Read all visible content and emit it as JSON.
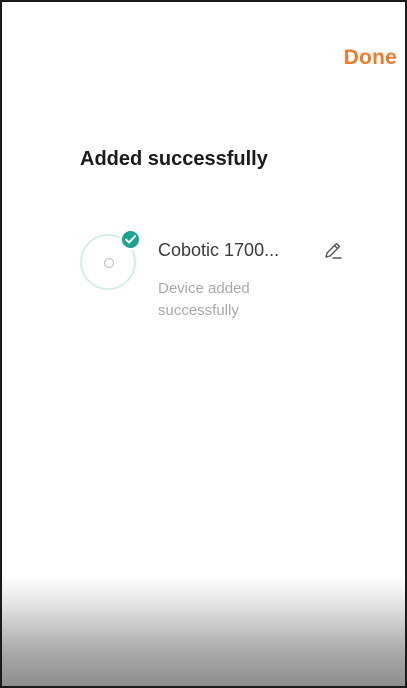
{
  "header": {
    "done_label": "Done"
  },
  "main": {
    "title": "Added successfully",
    "device": {
      "name": "Cobotic 1700...",
      "status": "Device added successfully",
      "icon": "robot-vacuum-icon",
      "badge_icon": "check-icon",
      "edit_icon": "pencil-icon"
    }
  },
  "colors": {
    "accent": "#f07a2a",
    "success": "#18a48f"
  }
}
